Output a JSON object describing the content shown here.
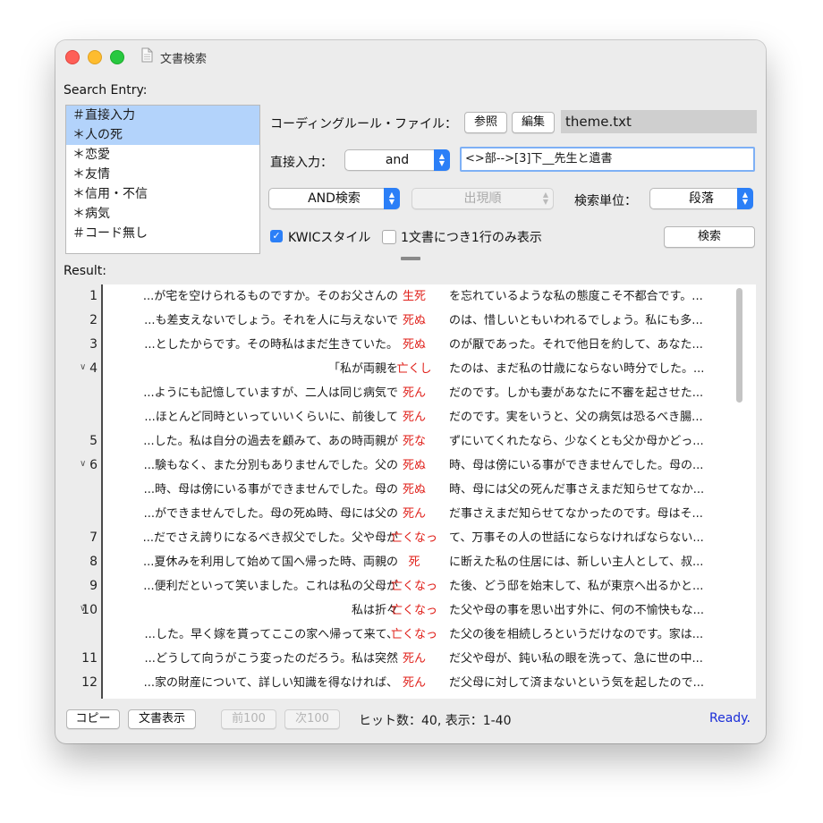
{
  "window": {
    "title": "文書検索"
  },
  "search_entry": {
    "label": "Search Entry:",
    "items": [
      {
        "text": "＃直接入力",
        "selected": true
      },
      {
        "text": "＊人の死",
        "selected": true
      },
      {
        "text": "＊恋愛",
        "selected": false
      },
      {
        "text": "＊友情",
        "selected": false
      },
      {
        "text": "＊信用・不信",
        "selected": false
      },
      {
        "text": "＊病気",
        "selected": false
      },
      {
        "text": "＃コード無し",
        "selected": false
      }
    ]
  },
  "coding_rule": {
    "label": "コーディングルール・ファイル：",
    "browse_label": "参照",
    "edit_label": "編集",
    "file_name": "theme.txt"
  },
  "direct_input": {
    "label": "直接入力：",
    "operator": "and",
    "query": "<>部-->[3]下__先生と遺書"
  },
  "options": {
    "search_mode": "AND検索",
    "sort_order": "出現順",
    "unit_label": "検索単位：",
    "unit": "段落",
    "search_button": "検索",
    "kwic_label": "KWICスタイル",
    "kwic_checked": true,
    "one_line_label": "1文書につき1行のみ表示",
    "one_line_checked": false
  },
  "result": {
    "label": "Result:",
    "rows": [
      {
        "num": "1",
        "fold": false,
        "left": "...が宅を空けられるものですか。そのお父さんの",
        "keyword": "生死",
        "right": "を忘れているような私の態度こそ不都合です。..."
      },
      {
        "num": "2",
        "fold": false,
        "left": "...も差支えないでしょう。それを人に与えないで",
        "keyword": "死ぬ",
        "right": "のは、惜しいともいわれるでしょう。私にも多..."
      },
      {
        "num": "3",
        "fold": false,
        "left": "...としたからです。その時私はまだ生きていた。",
        "keyword": "死ぬ",
        "right": "のが厭であった。それで他日を約して、あなた..."
      },
      {
        "num": "4",
        "fold": true,
        "left": "「私が両親を",
        "keyword": "亡くし",
        "right": "たのは、まだ私の廿歳にならない時分でした。..."
      },
      {
        "num": "",
        "fold": false,
        "left": "...ようにも記憶していますが、二人は同じ病気で",
        "keyword": "死ん",
        "right": "だのです。しかも妻があなたに不審を起させた..."
      },
      {
        "num": "",
        "fold": false,
        "left": "...ほとんど同時といっていいくらいに、前後して",
        "keyword": "死ん",
        "right": "だのです。実をいうと、父の病気は恐るべき腸..."
      },
      {
        "num": "5",
        "fold": false,
        "left": "...した。私は自分の過去を顧みて、あの時両親が",
        "keyword": "死な",
        "right": "ずにいてくれたなら、少なくとも父か母かどっ..."
      },
      {
        "num": "6",
        "fold": true,
        "left": "...験もなく、また分別もありませんでした。父の",
        "keyword": "死ぬ",
        "right": "時、母は傍にいる事ができませんでした。母の..."
      },
      {
        "num": "",
        "fold": false,
        "left": "...時、母は傍にいる事ができませんでした。母の",
        "keyword": "死ぬ",
        "right": "時、母には父の死んだ事さえまだ知らせてなか..."
      },
      {
        "num": "",
        "fold": false,
        "left": "...ができませんでした。母の死ぬ時、母には父の",
        "keyword": "死ん",
        "right": "だ事さえまだ知らせてなかったのです。母はそ..."
      },
      {
        "num": "7",
        "fold": false,
        "left": "...だでさえ誇りになるべき叔父でした。父や母が",
        "keyword": "亡くなっ",
        "right": "て、万事その人の世話にならなければならない..."
      },
      {
        "num": "8",
        "fold": false,
        "left": "...夏休みを利用して始めて国へ帰った時、両親の",
        "keyword": "死",
        "right": "に断えた私の住居には、新しい主人として、叔..."
      },
      {
        "num": "9",
        "fold": false,
        "left": "...便利だといって笑いました。これは私の父母が",
        "keyword": "亡くなっ",
        "right": "た後、どう邸を始末して、私が東京へ出るかと..."
      },
      {
        "num": "10",
        "fold": true,
        "left": "私は折々",
        "keyword": "亡くなっ",
        "right": "た父や母の事を思い出す外に、何の不愉快もな..."
      },
      {
        "num": "",
        "fold": false,
        "left": "...した。早く嫁を貰ってここの家へ帰って来て、",
        "keyword": "亡くなっ",
        "right": "た父の後を相続しろというだけなのです。家は..."
      },
      {
        "num": "11",
        "fold": false,
        "left": "...どうして向うがこう変ったのだろう。私は突然",
        "keyword": "死ん",
        "right": "だ父や母が、鈍い私の眼を洗って、急に世の中..."
      },
      {
        "num": "12",
        "fold": false,
        "left": "...家の財産について、詳しい知識を得なければ、",
        "keyword": "死ん",
        "right": "だ父母に対して済まないという気を起したので..."
      }
    ]
  },
  "footer": {
    "copy_label": "コピー",
    "show_doc_label": "文書表示",
    "prev_label": "前100",
    "next_label": "次100",
    "hits_text": "ヒット数：40, 表示：1-40",
    "status": "Ready."
  },
  "colors": {
    "keyword": "#e0201a",
    "selection": "#b3d3fb",
    "accent": "#2b7ff7",
    "status_ready": "#1a2dd8"
  }
}
